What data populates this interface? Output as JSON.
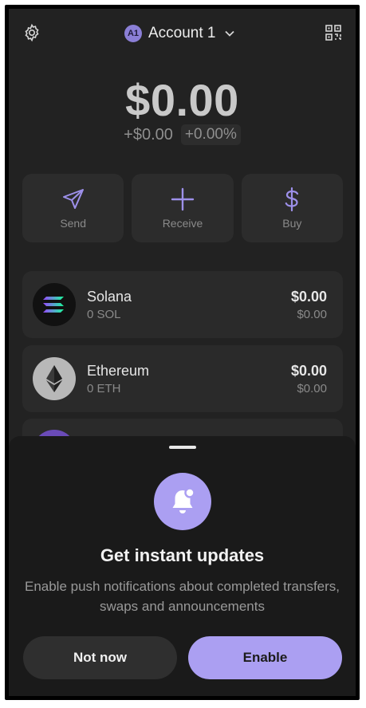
{
  "header": {
    "account_avatar": "A1",
    "account_name": "Account 1",
    "icons": [
      "gear-icon",
      "chevron-down-icon",
      "qr-code-icon"
    ]
  },
  "balance": {
    "total": "$0.00",
    "change_amount": "+$0.00",
    "change_percent": "+0.00%"
  },
  "actions": [
    {
      "label": "Send",
      "icon": "send-icon"
    },
    {
      "label": "Receive",
      "icon": "plus-icon"
    },
    {
      "label": "Buy",
      "icon": "dollar-icon"
    }
  ],
  "tokens": [
    {
      "name": "Solana",
      "amount": "0 SOL",
      "value": "$0.00",
      "usd": "$0.00",
      "icon": "solana-logo-icon"
    },
    {
      "name": "Ethereum",
      "amount": "0 ETH",
      "value": "$0.00",
      "usd": "$0.00",
      "icon": "ethereum-logo-icon"
    }
  ],
  "sheet": {
    "title": "Get instant updates",
    "body": "Enable push notifications about completed transfers, swaps and announcements",
    "secondary_button": "Not now",
    "primary_button": "Enable",
    "icon": "bell-icon"
  },
  "colors": {
    "background": "#222222",
    "card": "#2a2a2a",
    "accent": "#ab9ff2",
    "sheet": "#1a1a1a"
  }
}
